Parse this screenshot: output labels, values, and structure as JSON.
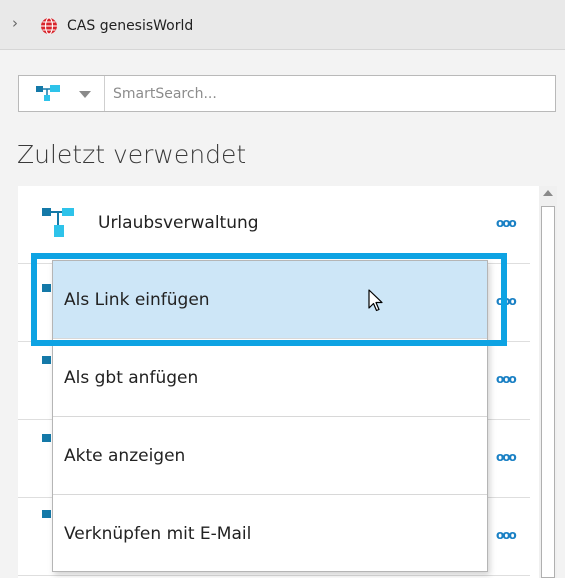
{
  "app": {
    "title": "CAS genesisWorld",
    "chevron": "›",
    "icon": "globe-icon"
  },
  "search": {
    "placeholder": "SmartSearch...",
    "value": "",
    "type_icon": "hierarchy-icon"
  },
  "recent": {
    "heading": "Zuletzt verwendet",
    "items": [
      {
        "label": "Urlaubsverwaltung",
        "icon": "hierarchy-icon",
        "more": "ooo"
      },
      {
        "label": "",
        "icon": "hierarchy-icon",
        "more": "ooo"
      },
      {
        "label": "",
        "icon": "hierarchy-icon",
        "more": "ooo"
      },
      {
        "label": "",
        "icon": "hierarchy-icon",
        "more": "ooo"
      },
      {
        "label": "",
        "icon": "hierarchy-icon",
        "more": "ooo"
      }
    ]
  },
  "context_menu": {
    "items": [
      {
        "label": "Als Link einfügen",
        "highlighted": true
      },
      {
        "label": "Als gbt anfügen"
      },
      {
        "label": "Akte anzeigen"
      },
      {
        "label": "Verknüpfen mit E-Mail"
      }
    ]
  },
  "colors": {
    "accent": "#0ea3e3",
    "highlight": "#cde6f7",
    "icon_dark": "#1479a8",
    "icon_light": "#2ec3ea",
    "link": "#1a80c4"
  }
}
